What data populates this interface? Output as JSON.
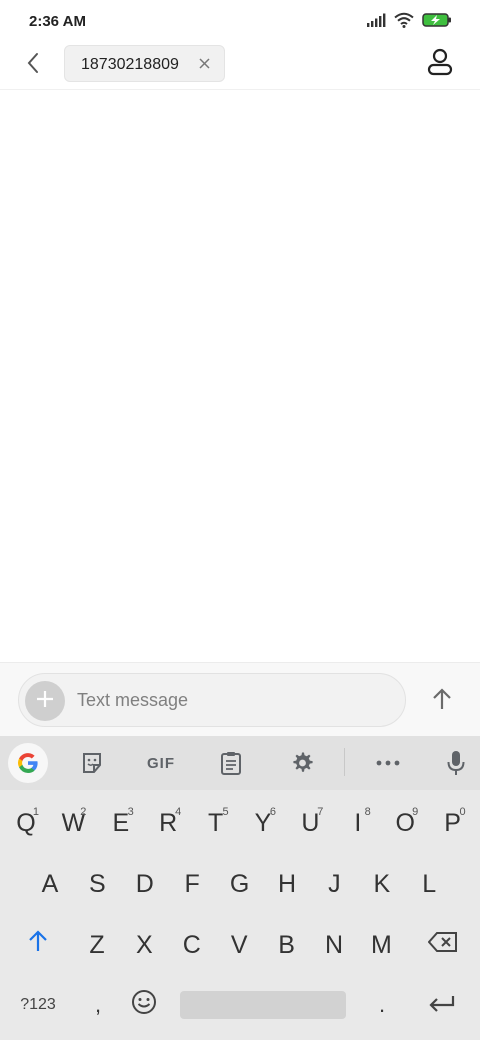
{
  "status_bar": {
    "time": "2:36 AM",
    "icons": [
      "signal-icon",
      "wifi-icon",
      "battery-charging-icon"
    ],
    "battery_color": "#3fbf3f"
  },
  "header": {
    "back_icon": "chevron-left-icon",
    "recipient": "18730218809",
    "remove_icon": "close-icon",
    "contact_icon": "person-icon"
  },
  "compose": {
    "placeholder": "Text message",
    "value": "",
    "attach_icon": "plus-icon",
    "send_icon": "arrow-up-icon"
  },
  "keyboard": {
    "toolbar": [
      "google-icon",
      "sticker-icon",
      "gif-button",
      "clipboard-icon",
      "settings-icon",
      "more-icon",
      "mic-icon"
    ],
    "gif_label": "GIF",
    "row1": [
      {
        "key": "Q",
        "hint": "1"
      },
      {
        "key": "W",
        "hint": "2"
      },
      {
        "key": "E",
        "hint": "3"
      },
      {
        "key": "R",
        "hint": "4"
      },
      {
        "key": "T",
        "hint": "5"
      },
      {
        "key": "Y",
        "hint": "6"
      },
      {
        "key": "U",
        "hint": "7"
      },
      {
        "key": "I",
        "hint": "8"
      },
      {
        "key": "O",
        "hint": "9"
      },
      {
        "key": "P",
        "hint": "0"
      }
    ],
    "row2": [
      "A",
      "S",
      "D",
      "F",
      "G",
      "H",
      "J",
      "K",
      "L"
    ],
    "row3": [
      "Z",
      "X",
      "C",
      "V",
      "B",
      "N",
      "M"
    ],
    "symbols_label": "?123",
    "comma_label": ",",
    "period_label": ".",
    "accent_color": "#1a73e8"
  }
}
